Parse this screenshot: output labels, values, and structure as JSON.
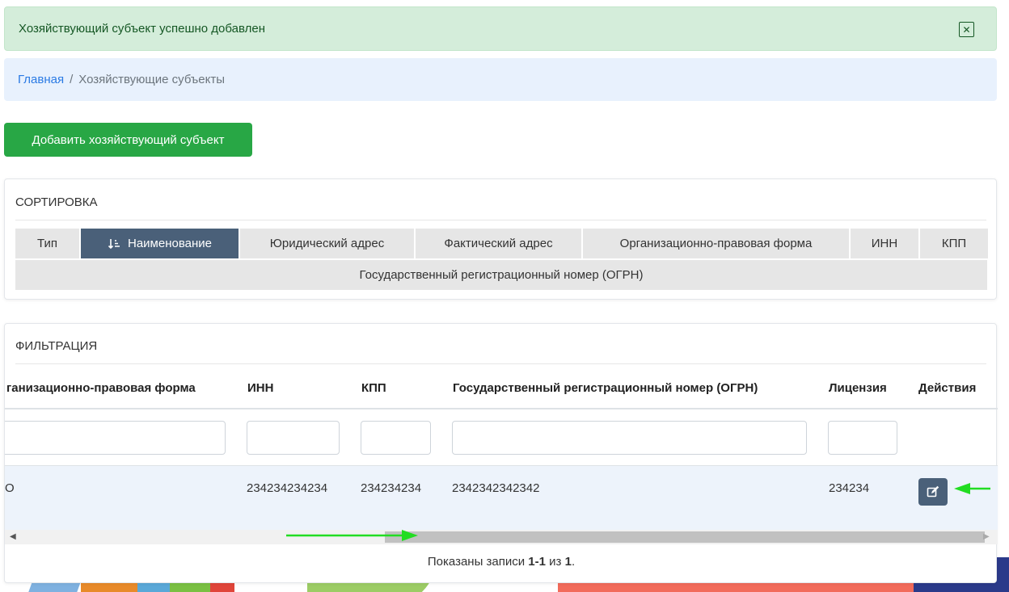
{
  "alert": {
    "message": "Хозяйствующий субъект успешно добавлен",
    "close_icon": "close-icon"
  },
  "breadcrumb": {
    "home": "Главная",
    "separator": "/",
    "current": "Хозяйствующие субъекты"
  },
  "add_button": "Добавить хозяйствующий субъект",
  "sort": {
    "title": "СОРТИРОВКА",
    "options": [
      "Тип",
      "Наименование",
      "Юридический адрес",
      "Фактический адрес",
      "Организационно-правовая форма",
      "ИНН",
      "КПП"
    ],
    "active": "Наименование",
    "active_icon": "sort-asc-icon",
    "option_row2": "Государственный регистрационный номер (ОГРН)"
  },
  "filter": {
    "title": "ФИЛЬТРАЦИЯ",
    "columns": [
      "ганизационно-правовая форма",
      "ИНН",
      "КПП",
      "Государственный регистрационный номер (ОГРН)",
      "Лицензия",
      "Действия"
    ],
    "row": {
      "form": "О",
      "inn": "234234234234",
      "kpp": "234234234",
      "ogrn": "2342342342342",
      "license": "234234"
    },
    "edit_icon": "edit-icon"
  },
  "summary": {
    "prefix": "Показаны записи",
    "range": "1-1",
    "of": "из",
    "total": "1",
    "suffix": "."
  },
  "colors": {
    "success_bg": "#d4edda",
    "success_text": "#155724",
    "breadcrumb_bg": "#e8f1fd",
    "link": "#2a7ae4",
    "add_button": "#28a745",
    "active_sort": "#4a6079",
    "annotation_arrow": "#22dd22"
  }
}
